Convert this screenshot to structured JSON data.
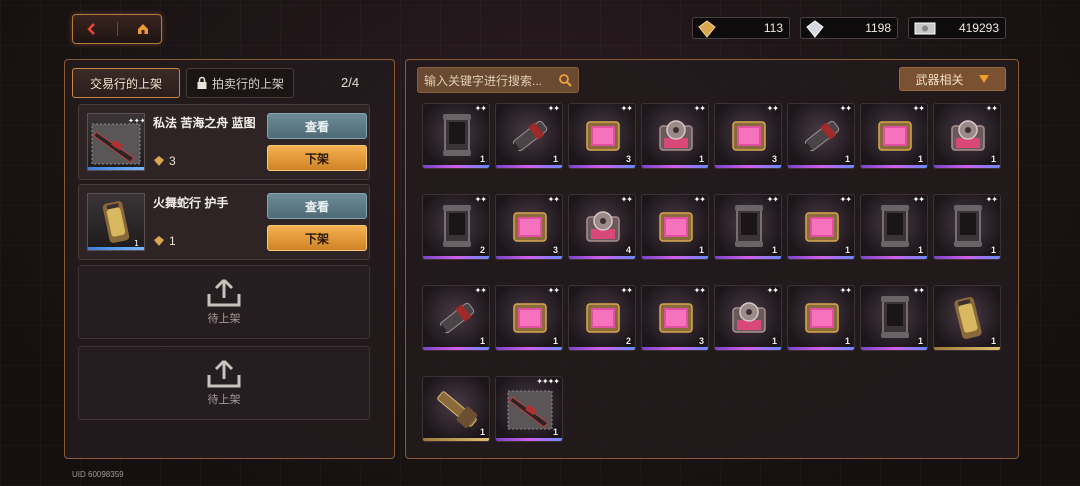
{
  "nav": {
    "back_icon": "back-arrow-icon",
    "home_icon": "home-icon"
  },
  "currencies": [
    {
      "icon": "gold-diamond-icon",
      "value": "113"
    },
    {
      "icon": "silver-diamond-icon",
      "value": "1198"
    },
    {
      "icon": "banknote-icon",
      "value": "419293"
    }
  ],
  "tabs": {
    "trading_house": "交易行的上架",
    "auction_house": "拍卖行的上架",
    "count": "2/4"
  },
  "listings": [
    {
      "name": "私法 苦海之舟 蓝图",
      "qty": "3",
      "view_label": "查看",
      "delist_label": "下架"
    },
    {
      "name": "火舞蛇行 护手",
      "qty": "1",
      "view_label": "查看",
      "delist_label": "下架"
    }
  ],
  "empty_slot_label": "待上架",
  "uid": "UID 60098359",
  "search": {
    "placeholder": "输入关键字进行搜索..."
  },
  "filter": {
    "label": "武器相关"
  },
  "colors": {
    "accent": "#c8864a",
    "view_button": "#5d7c88",
    "delist_button": "#e89a38"
  },
  "inventory": [
    {
      "type": "canister",
      "count": "1"
    },
    {
      "type": "barrel",
      "count": "1"
    },
    {
      "type": "pink-chip",
      "count": "3"
    },
    {
      "type": "gear-chip",
      "count": "1"
    },
    {
      "type": "pink-chip",
      "count": "3"
    },
    {
      "type": "barrel",
      "count": "1"
    },
    {
      "type": "pink-chip",
      "count": "1"
    },
    {
      "type": "gear-chip",
      "count": "1"
    },
    {
      "type": "canister",
      "count": "2"
    },
    {
      "type": "pink-chip",
      "count": "3"
    },
    {
      "type": "gear-chip",
      "count": "4"
    },
    {
      "type": "pink-chip",
      "count": "1"
    },
    {
      "type": "canister",
      "count": "1"
    },
    {
      "type": "pink-chip",
      "count": "1"
    },
    {
      "type": "canister",
      "count": "1"
    },
    {
      "type": "canister",
      "count": "1"
    },
    {
      "type": "barrel",
      "count": "1"
    },
    {
      "type": "pink-chip",
      "count": "1"
    },
    {
      "type": "pink-chip",
      "count": "2"
    },
    {
      "type": "pink-chip",
      "count": "3"
    },
    {
      "type": "gear-chip",
      "count": "1"
    },
    {
      "type": "pink-chip",
      "count": "1"
    },
    {
      "type": "canister",
      "count": "1"
    },
    {
      "type": "gauntlet",
      "count": "1"
    },
    {
      "type": "shotgun",
      "count": "1"
    },
    {
      "type": "rifle-blueprint",
      "count": "1"
    }
  ]
}
